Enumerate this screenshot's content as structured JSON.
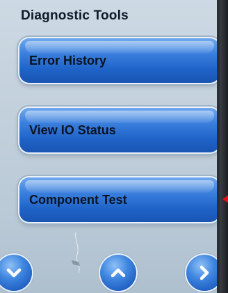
{
  "screen": {
    "title": "Diagnostic Tools"
  },
  "menu": [
    {
      "label": "Error History"
    },
    {
      "label": "View IO Status"
    },
    {
      "label": "Component Test"
    }
  ],
  "nav": {
    "down_icon": "chevron-down-icon",
    "up_icon": "chevron-up-icon",
    "next_icon": "chevron-right-icon"
  },
  "colors": {
    "accent": "#2a6fd4",
    "background": "#c4d2de",
    "indicator": "#e0121b"
  }
}
